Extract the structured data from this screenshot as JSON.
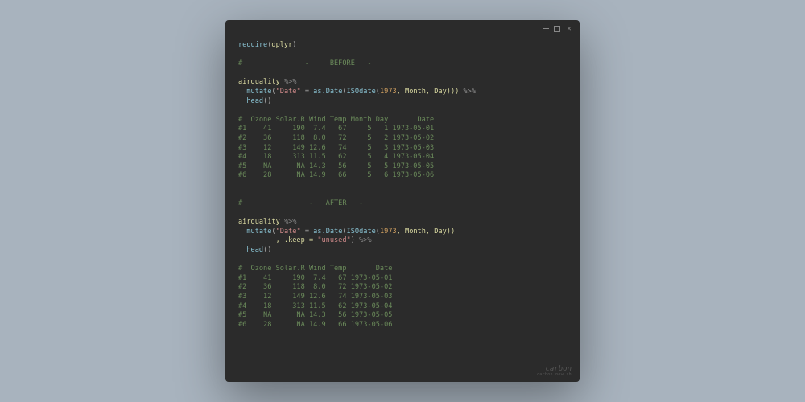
{
  "titlebar": {
    "minimize": "minimize",
    "maximize": "maximize",
    "close": "close"
  },
  "code": {
    "l1_require": "require",
    "l1_pkg": "dplyr",
    "l2_cmt": "#               -     BEFORE   -",
    "l4_ds": "airquality",
    "pipe": "%>%",
    "mutate": "mutate",
    "date_key": "\"Date\"",
    "eq": " = ",
    "asdate": "as.Date",
    "isodate": "ISOdate",
    "year": "1973",
    "month_arg": ", Month, Day)))",
    "month_arg2": ", Month, Day))",
    "head": "head",
    "empty_parens": "()",
    "before_table": "#  Ozone Solar.R Wind Temp Month Day       Date\n#1    41     190  7.4   67     5   1 1973-05-01\n#2    36     118  8.0   72     5   2 1973-05-02\n#3    12     149 12.6   74     5   3 1973-05-03\n#4    18     313 11.5   62     5   4 1973-05-04\n#5    NA      NA 14.3   56     5   5 1973-05-05\n#6    28      NA 14.9   66     5   6 1973-05-06",
    "after_cmt": "#                -   AFTER   -",
    "keep_arg": "         , .keep = ",
    "unused": "\"unused\"",
    "close_pipe": ") ",
    "after_table": "#  Ozone Solar.R Wind Temp       Date\n#1    41     190  7.4   67 1973-05-01\n#2    36     118  8.0   72 1973-05-02\n#3    12     149 12.6   74 1973-05-03\n#4    18     313 11.5   62 1973-05-04\n#5    NA      NA 14.3   56 1973-05-05\n#6    28      NA 14.9   66 1973-05-06"
  },
  "watermark": {
    "main": "carbon",
    "sub": "carbon.now.sh"
  }
}
